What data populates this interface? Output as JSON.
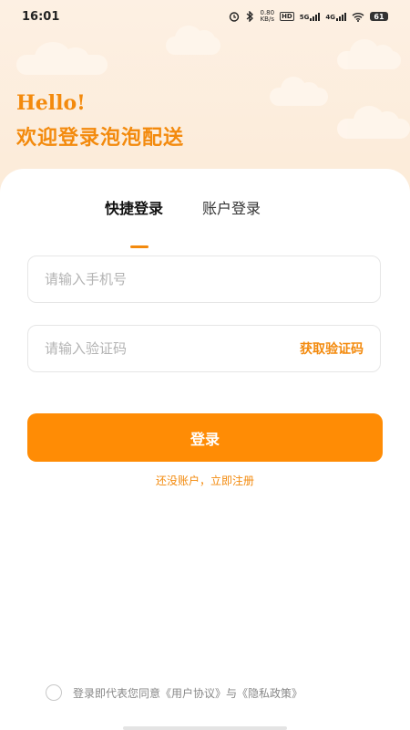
{
  "status_bar": {
    "time": "16:01",
    "net_speed_value": "0.80",
    "net_speed_unit": "KB/s",
    "hd_label": "HD",
    "signal_label": "5G",
    "signal2_label": "4G",
    "battery": "61"
  },
  "greeting": {
    "line1": "Hello!",
    "line2": "欢迎登录泡泡配送"
  },
  "tabs": [
    {
      "label": "快捷登录",
      "active": true
    },
    {
      "label": "账户登录",
      "active": false
    }
  ],
  "form": {
    "phone_placeholder": "请输入手机号",
    "code_placeholder": "请输入验证码",
    "get_code_label": "获取验证码",
    "login_label": "登录",
    "register_label": "还没账户，立即注册"
  },
  "agreement": {
    "prefix": "登录即代表您同意",
    "user_agreement": "《用户协议》",
    "conjunction": "与",
    "privacy_policy": "《隐私政策》"
  },
  "colors": {
    "accent": "#f38a0d",
    "button": "#ff8c05",
    "hero_bg": "#fdf0e2"
  }
}
